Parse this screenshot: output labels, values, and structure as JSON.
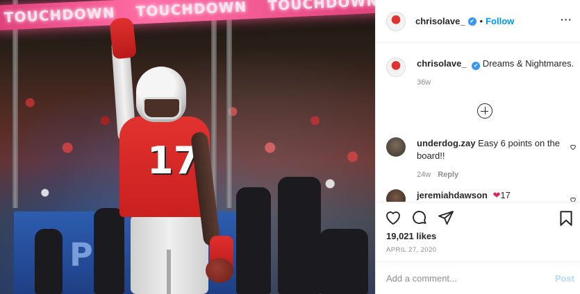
{
  "photo": {
    "banner_words": [
      "TOUCHDOWN",
      "TOUCHDOWN",
      "TOUCHDOWN"
    ],
    "jersey_number": "17",
    "sign_text": "Pla"
  },
  "header": {
    "username": "chrisolave_",
    "verified": "✔",
    "separator": "•",
    "follow_label": "Follow",
    "more_label": "···"
  },
  "caption": {
    "username": "chrisolave_",
    "text": "Dreams & Nightmares.",
    "age": "36w"
  },
  "comments": [
    {
      "username": "underdog.zay",
      "text": "Easy 6 points on the board!!",
      "age": "24w",
      "reply_label": "Reply"
    },
    {
      "username": "jeremiahdawson",
      "text": "17"
    }
  ],
  "post": {
    "likes": "19,021 likes",
    "date": "APRIL 27, 2020"
  },
  "add_comment": {
    "placeholder": "Add a comment...",
    "post_label": "Post"
  }
}
